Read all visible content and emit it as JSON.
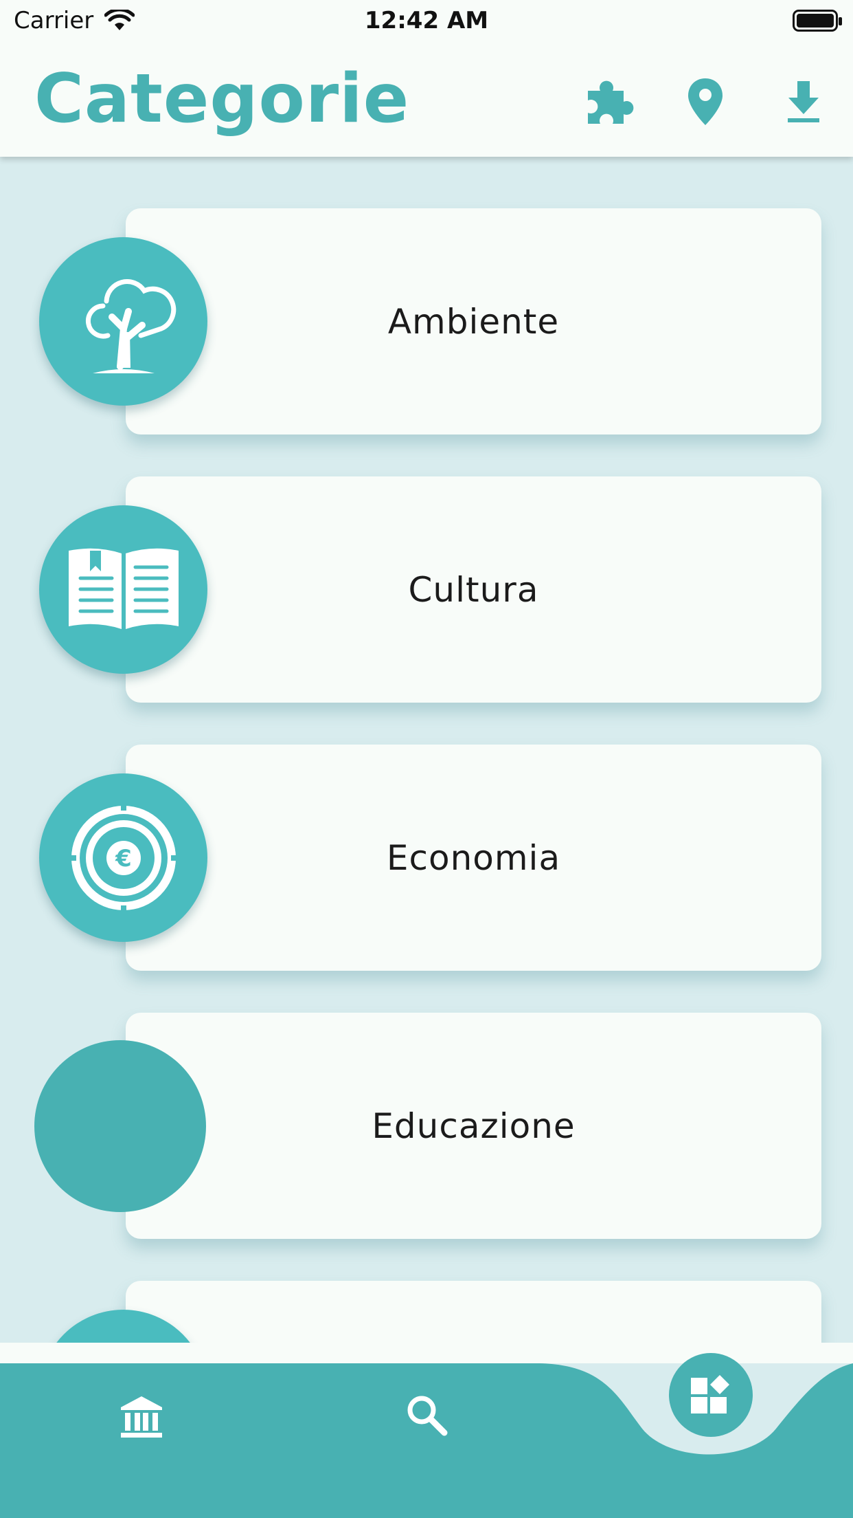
{
  "status_bar": {
    "carrier": "Carrier",
    "time": "12:42 AM"
  },
  "header": {
    "title": "Categorie",
    "actions": [
      "puzzle-icon",
      "location-pin-icon",
      "download-icon"
    ]
  },
  "categories": [
    {
      "label": "Ambiente",
      "icon": "tree-icon"
    },
    {
      "label": "Cultura",
      "icon": "open-book-icon"
    },
    {
      "label": "Economia",
      "icon": "euro-coin-icon"
    },
    {
      "label": "Educazione",
      "icon": ""
    }
  ],
  "bottom_nav": {
    "items": [
      "museum-icon",
      "search-icon",
      "categories-grid-icon"
    ],
    "selected": "categories-grid-icon"
  },
  "colors": {
    "accent": "#48b1b2",
    "bubble": "#4abcbf",
    "background": "#d8ecee",
    "card": "#f8fcf9"
  }
}
